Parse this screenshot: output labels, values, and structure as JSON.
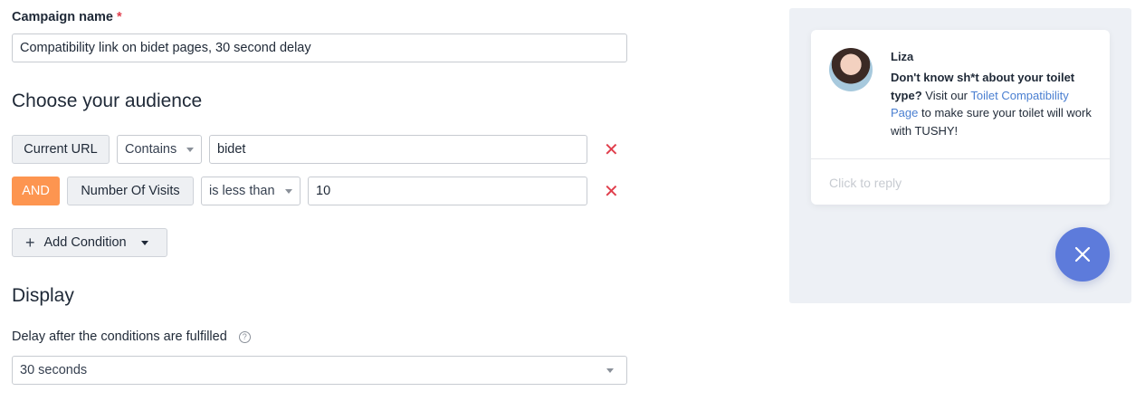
{
  "campaign": {
    "label": "Campaign name",
    "required_mark": "*",
    "value": "Compatibility link on bidet pages, 30 second delay"
  },
  "audience": {
    "title": "Choose your audience",
    "conditions": [
      {
        "field": "Current URL",
        "operator": "Contains",
        "value": "bidet"
      },
      {
        "connector": "AND",
        "field": "Number Of Visits",
        "operator": "is less than",
        "value": "10"
      }
    ],
    "add_condition_label": "Add Condition",
    "remove_glyph": "✕"
  },
  "display": {
    "title": "Display",
    "delay_label": "Delay after the conditions are fulfilled",
    "help_glyph": "?",
    "delay_value": "30 seconds"
  },
  "preview": {
    "sender": "Liza",
    "message_bold": "Don't know sh*t about your toilet type?",
    "message_pre_link": " Visit our ",
    "message_link": "Toilet Compatibility Page",
    "message_post_link": " to make sure your toilet will work with TUSHY!",
    "reply_placeholder": "Click to reply",
    "close_glyph": "✕"
  },
  "colors": {
    "accent_orange": "#fd9550",
    "remove_red": "#e03e4c",
    "link_blue": "#4a7fd1",
    "fab_blue": "#5d7bdb",
    "preview_bg": "#edf0f5"
  },
  "icons": [
    "plus-icon",
    "caret-down-icon",
    "help-icon",
    "remove-icon",
    "close-icon",
    "avatar"
  ]
}
